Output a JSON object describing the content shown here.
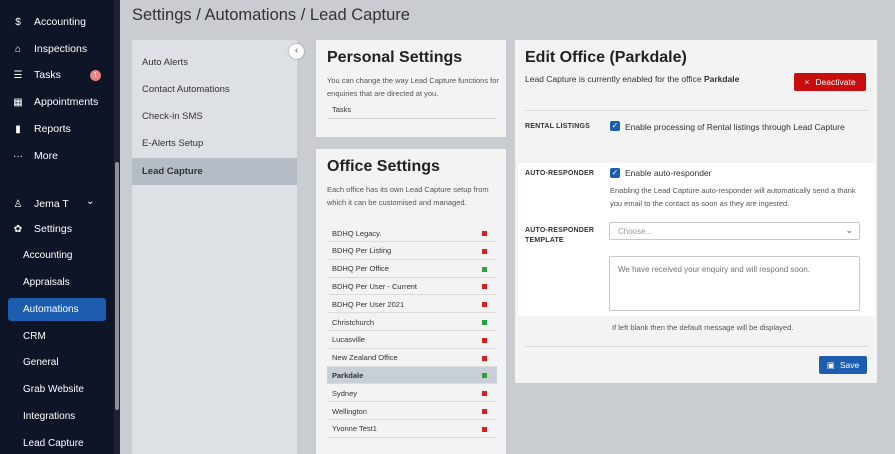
{
  "sidebar": {
    "items": [
      {
        "label": "Accounting",
        "icon": "dollar-icon",
        "glyph": "$"
      },
      {
        "label": "Inspections",
        "icon": "home-search-icon",
        "glyph": "⌂"
      },
      {
        "label": "Tasks",
        "icon": "tasks-icon",
        "glyph": "☰",
        "badge": "1"
      },
      {
        "label": "Appointments",
        "icon": "calendar-icon",
        "glyph": "▦"
      },
      {
        "label": "Reports",
        "icon": "bar-chart-icon",
        "glyph": "▮"
      },
      {
        "label": "More",
        "icon": "more-dots-icon",
        "glyph": "···"
      }
    ],
    "user": {
      "name": "Jema T",
      "icon": "user-icon",
      "glyph": "♙",
      "chevron": "⌄"
    },
    "settings": {
      "label": "Settings",
      "icon": "gear-icon",
      "glyph": "✿"
    },
    "settings_items": [
      "Accounting",
      "Appraisals",
      "Automations",
      "CRM",
      "General",
      "Grab Website",
      "Integrations",
      "Lead Capture"
    ],
    "active_settings_item": "Automations",
    "colors": {
      "background": "#0d1526",
      "active": "#1d5db0",
      "badge": "#f08080"
    }
  },
  "header": {
    "title": "Settings / Automations / Lead Capture"
  },
  "subnav": {
    "items": [
      "Auto Alerts",
      "Contact Automations",
      "Check-in SMS",
      "E-Alerts Setup",
      "Lead Capture"
    ],
    "active": "Lead Capture",
    "collapse_glyph": "‹"
  },
  "personal_settings": {
    "title": "Personal Settings",
    "description": "You can change the way Lead Capture functions for enquiries that are directed at you.",
    "items": [
      "Tasks"
    ]
  },
  "office_settings": {
    "title": "Office Settings",
    "description": "Each office has its own Lead Capture setup from which it can be customised and managed.",
    "offices": [
      {
        "name": "BDHQ Legacy.",
        "status": "red"
      },
      {
        "name": "BDHQ Per Listing",
        "status": "red"
      },
      {
        "name": "BDHQ Per Office",
        "status": "green"
      },
      {
        "name": "BDHQ Per User - Current",
        "status": "red"
      },
      {
        "name": "BDHQ Per User 2021",
        "status": "red"
      },
      {
        "name": "Christchurch",
        "status": "green"
      },
      {
        "name": "Lucasville",
        "status": "red"
      },
      {
        "name": "New Zealand Office",
        "status": "red"
      },
      {
        "name": "Parkdale",
        "status": "green",
        "active": true
      },
      {
        "name": "Sydney",
        "status": "red"
      },
      {
        "name": "Wellington",
        "status": "red"
      },
      {
        "name": "Yvonne Test1",
        "status": "red"
      }
    ],
    "status_colors": {
      "red": "#d62020",
      "green": "#2ea043"
    }
  },
  "edit_office": {
    "title": "Edit Office (Parkdale)",
    "status_prefix": "Lead Capture is currently enabled for the office ",
    "office_name": "Parkdale",
    "deactivate_label": "Deactivate",
    "deactivate_icon": "×",
    "rental_listings_label": "RENTAL LISTINGS",
    "rental_listings_text": "Enable processing of Rental listings through Lead Capture",
    "auto_responder_label": "AUTO-RESPONDER",
    "auto_responder_text": "Enable auto-responder",
    "auto_responder_help": "Enabling the Lead Capture auto-responder will automatically send a thank you email to the contact as soon as they are ingested.",
    "template_label": "AUTO-RESPONDER TEMPLATE",
    "template_select_placeholder": "Choose...",
    "template_textarea_placeholder": "We have received your enquiry and will respond soon.",
    "blank_note": "If left blank then the default message will be displayed.",
    "save_label": "Save",
    "save_icon": "▣",
    "check_glyph": "✓",
    "chevron_glyph": "⌄"
  }
}
